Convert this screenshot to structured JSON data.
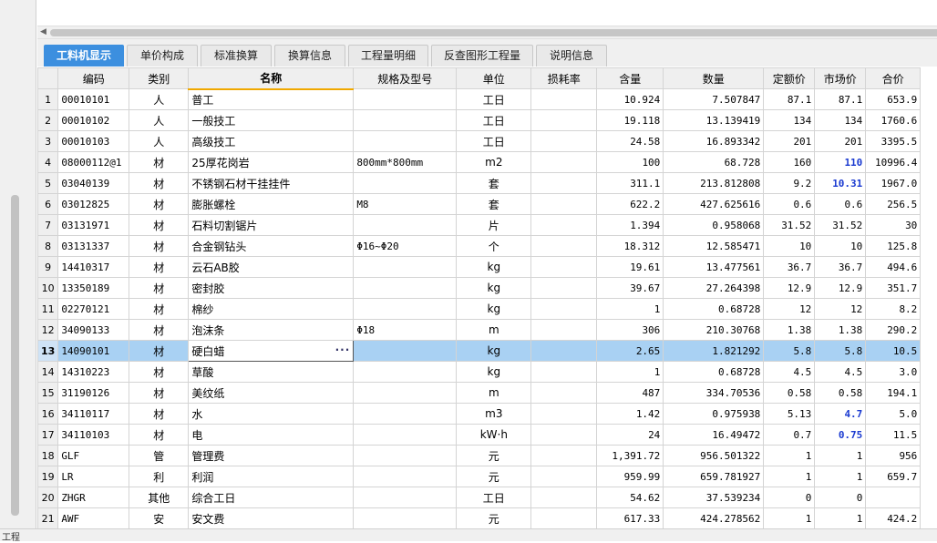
{
  "tabs": [
    "工料机显示",
    "单价构成",
    "标准换算",
    "换算信息",
    "工程量明细",
    "反查图形工程量",
    "说明信息"
  ],
  "columns": [
    "编码",
    "类别",
    "名称",
    "规格及型号",
    "单位",
    "损耗率",
    "含量",
    "数量",
    "定额价",
    "市场价",
    "合价"
  ],
  "rows": [
    {
      "n": "1",
      "code": "00010101",
      "cat": "人",
      "name": "普工",
      "spec": "",
      "unit": "工日",
      "loss": "",
      "qty": "10.924",
      "amount": "7.507847",
      "price": "87.1",
      "market": "87.1",
      "total": "653.9"
    },
    {
      "n": "2",
      "code": "00010102",
      "cat": "人",
      "name": "一般技工",
      "spec": "",
      "unit": "工日",
      "loss": "",
      "qty": "19.118",
      "amount": "13.139419",
      "price": "134",
      "market": "134",
      "total": "1760.6"
    },
    {
      "n": "3",
      "code": "00010103",
      "cat": "人",
      "name": "高级技工",
      "spec": "",
      "unit": "工日",
      "loss": "",
      "qty": "24.58",
      "amount": "16.893342",
      "price": "201",
      "market": "201",
      "total": "3395.5"
    },
    {
      "n": "4",
      "code": "08000112@1",
      "cat": "材",
      "name": "25厚花岗岩",
      "spec": "800mm*800mm",
      "unit": "m2",
      "loss": "",
      "qty": "100",
      "amount": "68.728",
      "price": "160",
      "market": "110",
      "total": "10996.4"
    },
    {
      "n": "5",
      "code": "03040139",
      "cat": "材",
      "name": "不锈钢石材干挂挂件",
      "spec": "",
      "unit": "套",
      "loss": "",
      "qty": "311.1",
      "amount": "213.812808",
      "price": "9.2",
      "market": "10.31",
      "total": "1967.0"
    },
    {
      "n": "6",
      "code": "03012825",
      "cat": "材",
      "name": "膨胀螺栓",
      "spec": "M8",
      "unit": "套",
      "loss": "",
      "qty": "622.2",
      "amount": "427.625616",
      "price": "0.6",
      "market": "0.6",
      "total": "256.5"
    },
    {
      "n": "7",
      "code": "03131971",
      "cat": "材",
      "name": "石料切割锯片",
      "spec": "",
      "unit": "片",
      "loss": "",
      "qty": "1.394",
      "amount": "0.958068",
      "price": "31.52",
      "market": "31.52",
      "total": "30"
    },
    {
      "n": "8",
      "code": "03131337",
      "cat": "材",
      "name": "合金钢钻头",
      "spec": "Φ16~Φ20",
      "unit": "个",
      "loss": "",
      "qty": "18.312",
      "amount": "12.585471",
      "price": "10",
      "market": "10",
      "total": "125.8"
    },
    {
      "n": "9",
      "code": "14410317",
      "cat": "材",
      "name": "云石AB胶",
      "spec": "",
      "unit": "kg",
      "loss": "",
      "qty": "19.61",
      "amount": "13.477561",
      "price": "36.7",
      "market": "36.7",
      "total": "494.6"
    },
    {
      "n": "10",
      "code": "13350189",
      "cat": "材",
      "name": "密封胶",
      "spec": "",
      "unit": "kg",
      "loss": "",
      "qty": "39.67",
      "amount": "27.264398",
      "price": "12.9",
      "market": "12.9",
      "total": "351.7"
    },
    {
      "n": "11",
      "code": "02270121",
      "cat": "材",
      "name": "棉纱",
      "spec": "",
      "unit": "kg",
      "loss": "",
      "qty": "1",
      "amount": "0.68728",
      "price": "12",
      "market": "12",
      "total": "8.2"
    },
    {
      "n": "12",
      "code": "34090133",
      "cat": "材",
      "name": "泡沫条",
      "spec": "Φ18",
      "unit": "m",
      "loss": "",
      "qty": "306",
      "amount": "210.30768",
      "price": "1.38",
      "market": "1.38",
      "total": "290.2"
    },
    {
      "n": "13",
      "code": "14090101",
      "cat": "材",
      "name": "硬白蜡",
      "spec": "",
      "unit": "kg",
      "loss": "",
      "qty": "2.65",
      "amount": "1.821292",
      "price": "5.8",
      "market": "5.8",
      "total": "10.5"
    },
    {
      "n": "14",
      "code": "14310223",
      "cat": "材",
      "name": "草酸",
      "spec": "",
      "unit": "kg",
      "loss": "",
      "qty": "1",
      "amount": "0.68728",
      "price": "4.5",
      "market": "4.5",
      "total": "3.0"
    },
    {
      "n": "15",
      "code": "31190126",
      "cat": "材",
      "name": "美纹纸",
      "spec": "",
      "unit": "m",
      "loss": "",
      "qty": "487",
      "amount": "334.70536",
      "price": "0.58",
      "market": "0.58",
      "total": "194.1"
    },
    {
      "n": "16",
      "code": "34110117",
      "cat": "材",
      "name": "水",
      "spec": "",
      "unit": "m3",
      "loss": "",
      "qty": "1.42",
      "amount": "0.975938",
      "price": "5.13",
      "market": "4.7",
      "total": "5.0"
    },
    {
      "n": "17",
      "code": "34110103",
      "cat": "材",
      "name": "电",
      "spec": "",
      "unit": "kW·h",
      "loss": "",
      "qty": "24",
      "amount": "16.49472",
      "price": "0.7",
      "market": "0.75",
      "total": "11.5"
    },
    {
      "n": "18",
      "code": "GLF",
      "cat": "管",
      "name": "管理费",
      "spec": "",
      "unit": "元",
      "loss": "",
      "qty": "1,391.72",
      "amount": "956.501322",
      "price": "1",
      "market": "1",
      "total": "956"
    },
    {
      "n": "19",
      "code": "LR",
      "cat": "利",
      "name": "利润",
      "spec": "",
      "unit": "元",
      "loss": "",
      "qty": "959.99",
      "amount": "659.781927",
      "price": "1",
      "market": "1",
      "total": "659.7"
    },
    {
      "n": "20",
      "code": "ZHGR",
      "cat": "其他",
      "name": "综合工日",
      "spec": "",
      "unit": "工日",
      "loss": "",
      "qty": "54.62",
      "amount": "37.539234",
      "price": "0",
      "market": "0",
      "total": ""
    },
    {
      "n": "21",
      "code": "AWF",
      "cat": "安",
      "name": "安文费",
      "spec": "",
      "unit": "元",
      "loss": "",
      "qty": "617.33",
      "amount": "424.278562",
      "price": "1",
      "market": "1",
      "total": "424.2"
    }
  ],
  "selected_row": "13",
  "highlight_market_rows": [
    "4",
    "5",
    "16",
    "17"
  ],
  "bottom_label": "工程",
  "colors": {
    "tab_active": "#3c8fdf",
    "selected_row": "#a9d1f3",
    "market_highlight": "#1a3ad0",
    "header_accent": "#f0a800"
  }
}
